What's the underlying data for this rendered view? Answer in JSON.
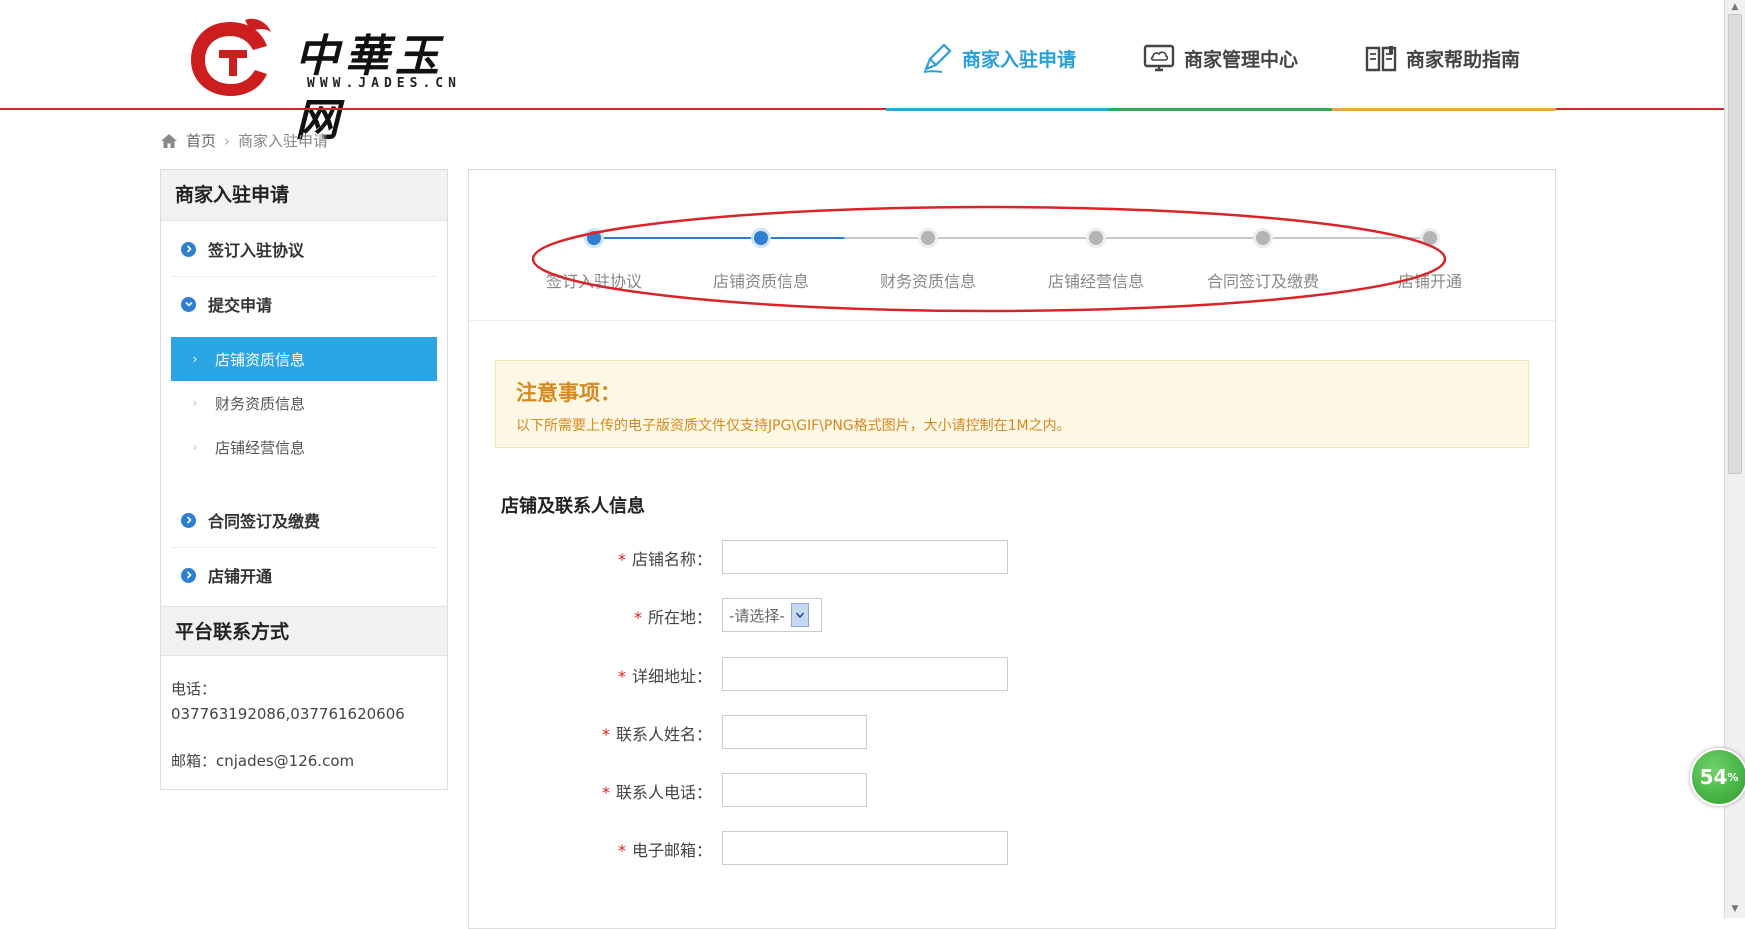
{
  "header": {
    "logo_cn": "中華玉网",
    "logo_en": "WWW.JADES.CN",
    "nav": [
      {
        "label": "商家入驻申请",
        "active": true
      },
      {
        "label": "商家管理中心",
        "active": false
      },
      {
        "label": "商家帮助指南",
        "active": false
      }
    ]
  },
  "breadcrumb": {
    "home": "首页",
    "current": "商家入驻申请"
  },
  "sidebar": {
    "title": "商家入驻申请",
    "items": [
      {
        "label": "签订入驻协议"
      },
      {
        "label": "提交申请"
      },
      {
        "label": "合同签订及缴费"
      },
      {
        "label": "店铺开通"
      }
    ],
    "sub_items": [
      {
        "label": "店铺资质信息",
        "active": true
      },
      {
        "label": "财务资质信息",
        "active": false
      },
      {
        "label": "店铺经营信息",
        "active": false
      }
    ],
    "contact_title": "平台联系方式",
    "phone_label": "电话：",
    "phone_value": "037763192086,037761620606",
    "email_line": "邮箱：cnjades@126.com"
  },
  "steps": [
    {
      "label": "签订入驻协议",
      "done": true
    },
    {
      "label": "店铺资质信息",
      "done": true
    },
    {
      "label": "财务资质信息",
      "done": false
    },
    {
      "label": "店铺经营信息",
      "done": false
    },
    {
      "label": "合同签订及缴费",
      "done": false
    },
    {
      "label": "店铺开通",
      "done": false
    }
  ],
  "notice": {
    "title": "注意事项：",
    "text": "以下所需要上传的电子版资质文件仅支持JPG\\GIF\\PNG格式图片，大小请控制在1M之内。"
  },
  "form": {
    "section_title": "店铺及联系人信息",
    "required_mark": "*",
    "fields": [
      {
        "label": "店铺名称：",
        "value": ""
      },
      {
        "label": "所在地：",
        "value": "-请选择-"
      },
      {
        "label": "详细地址：",
        "value": ""
      },
      {
        "label": "联系人姓名：",
        "value": ""
      },
      {
        "label": "联系人电话：",
        "value": ""
      },
      {
        "label": "电子邮箱：",
        "value": ""
      }
    ]
  },
  "badge": {
    "value": "54",
    "unit": "%"
  },
  "colors": {
    "accent": "#2aa6e5",
    "brand_red": "#d9252a",
    "notice": "#d48a22"
  }
}
